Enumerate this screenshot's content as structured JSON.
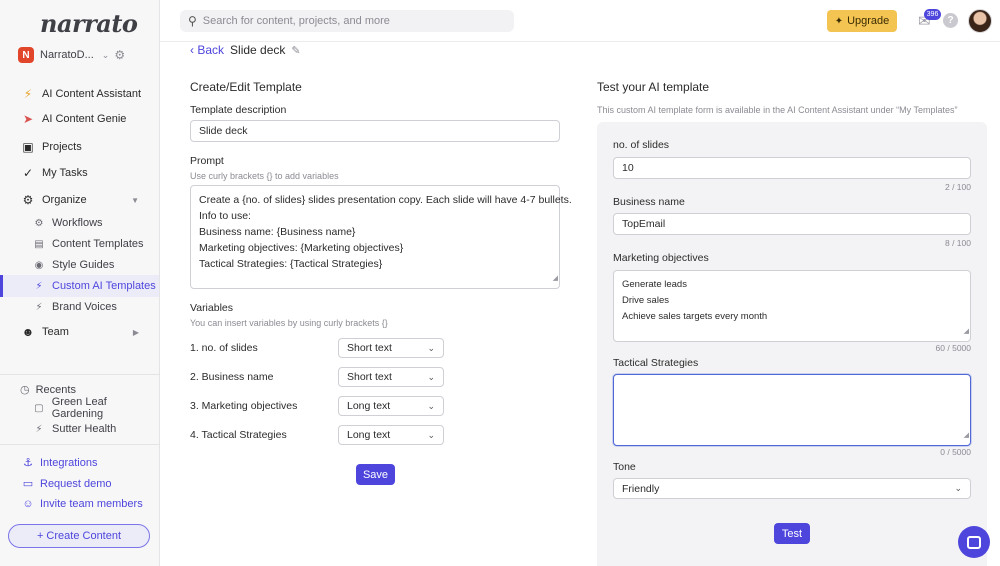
{
  "brand": {
    "logo": "narrato",
    "workspace_initial": "N",
    "workspace_name": "NarratoD..."
  },
  "sidebar": {
    "items": [
      {
        "label": "AI Content Assistant",
        "icon": "bolt-icon"
      },
      {
        "label": "AI Content Genie",
        "icon": "rocket-icon"
      },
      {
        "label": "Projects",
        "icon": "briefcase-icon"
      },
      {
        "label": "My Tasks",
        "icon": "check-icon"
      },
      {
        "label": "Organize",
        "icon": "gears-icon"
      }
    ],
    "organize_items": [
      {
        "label": "Workflows",
        "icon": "workflow-icon"
      },
      {
        "label": "Content Templates",
        "icon": "template-icon"
      },
      {
        "label": "Style Guides",
        "icon": "palette-icon"
      },
      {
        "label": "Custom AI Templates",
        "icon": "bolt-icon"
      },
      {
        "label": "Brand Voices",
        "icon": "bolt-icon"
      }
    ],
    "team_label": "Team",
    "recents_label": "Recents",
    "recents": [
      {
        "label": "Green Leaf Gardening",
        "icon": "cube-icon"
      },
      {
        "label": "Sutter Health",
        "icon": "bolt-icon"
      }
    ],
    "links": [
      {
        "label": "Integrations",
        "icon": "integrations-icon"
      },
      {
        "label": "Request demo",
        "icon": "monitor-icon"
      },
      {
        "label": "Invite team members",
        "icon": "add-user-icon"
      }
    ],
    "create_label": "+ Create Content"
  },
  "topbar": {
    "search_placeholder": "Search for content, projects, and more",
    "upgrade_label": "Upgrade",
    "mail_count": "396",
    "help_label": "?"
  },
  "header": {
    "back_label": "Back",
    "title": "Slide deck"
  },
  "editor": {
    "heading": "Create/Edit Template",
    "description_label": "Template description",
    "description_value": "Slide deck",
    "prompt_label": "Prompt",
    "prompt_hint": "Use curly brackets {} to add variables",
    "prompt_lines": [
      "Create a {no. of slides} slides presentation copy. Each slide will have 4-7 bullets.",
      "Info to use:",
      "Business name: {Business name}",
      "Marketing objectives: {Marketing objectives}",
      "Tactical Strategies: {Tactical Strategies}"
    ],
    "variables_label": "Variables",
    "variables_hint": "You can insert variables by using curly brackets {}",
    "variables": [
      {
        "name": "1. no. of slides",
        "type": "Short text"
      },
      {
        "name": "2. Business name",
        "type": "Short text"
      },
      {
        "name": "3. Marketing objectives",
        "type": "Long text"
      },
      {
        "name": "4. Tactical Strategies",
        "type": "Long text"
      }
    ],
    "save_label": "Save"
  },
  "tester": {
    "heading": "Test your AI template",
    "subtitle": "This custom AI template form is available in the AI Content Assistant under “My Templates”",
    "slides_label": "no. of slides",
    "slides_value": "10",
    "slides_counter": "2 / 100",
    "business_label": "Business name",
    "business_value": "TopEmail",
    "business_counter": "8 / 100",
    "objectives_label": "Marketing objectives",
    "objectives_lines": [
      "Generate leads",
      "Drive sales",
      "Achieve sales targets every month"
    ],
    "objectives_counter": "60 / 5000",
    "strategies_label": "Tactical Strategies",
    "strategies_value": "",
    "strategies_counter": "0 / 5000",
    "tone_label": "Tone",
    "tone_value": "Friendly",
    "test_label": "Test"
  },
  "colors": {
    "accent": "#4e46dc",
    "upgrade": "#f4c452",
    "workspace_badge": "#e2462a",
    "bolt": "#e6a52c"
  }
}
